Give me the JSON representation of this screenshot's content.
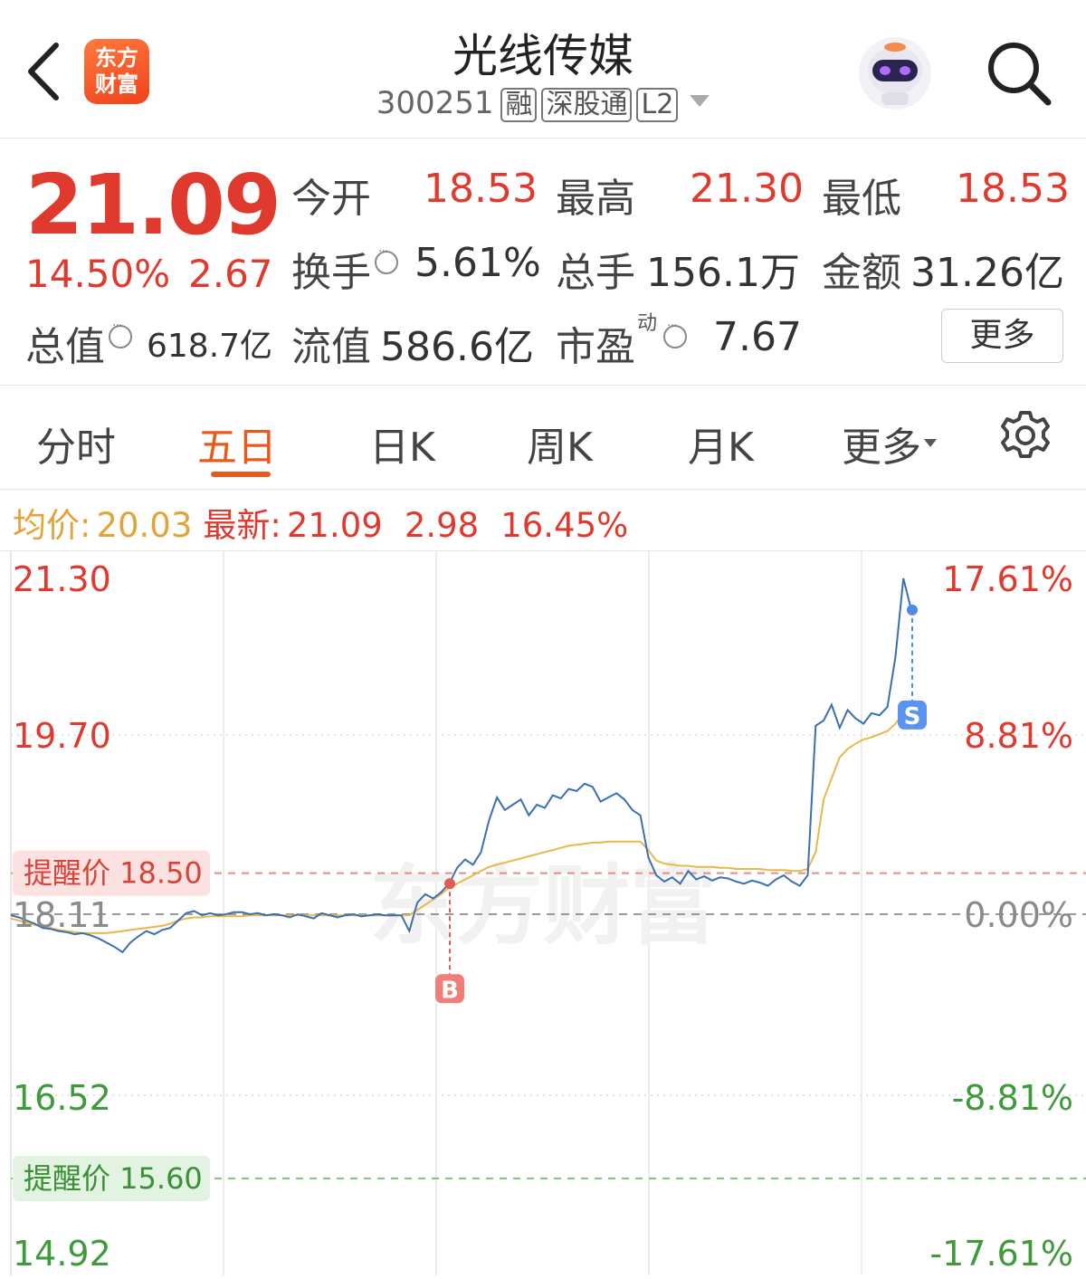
{
  "header": {
    "title": "光线传媒",
    "code": "300251",
    "tags": [
      "融",
      "深股通",
      "L2"
    ],
    "logo_lines": [
      "东方",
      "财富"
    ]
  },
  "quote": {
    "price": "21.09",
    "change_pct": "14.50%",
    "change": "2.67",
    "open_label": "今开",
    "open": "18.53",
    "high_label": "最高",
    "high": "21.30",
    "low_label": "最低",
    "low": "18.53",
    "turnover_label": "换手",
    "turnover": "5.61%",
    "volume_label": "总手",
    "volume": "156.1万",
    "amount_label": "金额",
    "amount": "31.26亿",
    "mcap_label": "总值",
    "mcap": "618.7亿",
    "float_label": "流值",
    "float": "586.6亿",
    "pe_label": "市盈",
    "pe_sup": "动",
    "pe": "7.67",
    "more_label": "更多"
  },
  "tabs": {
    "items": [
      "分时",
      "五日",
      "日K",
      "周K",
      "月K",
      "更多"
    ],
    "active": "五日"
  },
  "summary": {
    "avg_label": "均价:",
    "avg_value": "20.03",
    "latest_label": "最新:",
    "latest_value": "21.09",
    "change": "2.98",
    "change_pct": "16.45%"
  },
  "colors": {
    "up": "#e03a2f",
    "down": "#3e9a3a",
    "price_line": "#3a6fb0",
    "avg_line": "#e8b84a",
    "accent": "#e85a1c"
  },
  "chart_data": {
    "type": "line",
    "title": "",
    "xlabel": "",
    "ylabel": "",
    "days": 5,
    "ylim": [
      14.92,
      21.3
    ],
    "base_price": 18.11,
    "y_ticks_left": [
      "21.30",
      "19.70",
      "18.11",
      "16.52",
      "14.92"
    ],
    "y_ticks_right": [
      "17.61%",
      "8.81%",
      "0.00%",
      "-8.81%",
      "-17.61%"
    ],
    "alerts": [
      {
        "label": "提醒价",
        "value": "18.50",
        "color": "#e03a2f"
      },
      {
        "label": "提醒价",
        "value": "15.60",
        "color": "#3e9a3a"
      }
    ],
    "markers": [
      {
        "label": "B",
        "price": 18.4,
        "day": 2
      },
      {
        "label": "S",
        "price": 21.0,
        "day": 5
      }
    ],
    "watermark": "东方财富",
    "series": [
      {
        "key": "price",
        "values": [
          18.1,
          18.08,
          18.05,
          18.02,
          17.98,
          17.97,
          17.95,
          17.94,
          17.92,
          17.93,
          17.91,
          17.88,
          17.84,
          17.8,
          17.75,
          17.84,
          17.9,
          17.95,
          17.92,
          17.96,
          17.98,
          18.05,
          18.12,
          18.14,
          18.1,
          18.12,
          18.1,
          18.11,
          18.13,
          18.13,
          18.11,
          18.12,
          18.1,
          18.11,
          18.1,
          18.08,
          18.11,
          18.09,
          18.07,
          18.12,
          18.1,
          18.08,
          18.1,
          18.11,
          18.09,
          18.1,
          18.11,
          18.1,
          18.1,
          18.1,
          17.95,
          18.22,
          18.3,
          18.26,
          18.32,
          18.4,
          18.55,
          18.63,
          18.58,
          18.7,
          19.0,
          19.22,
          19.1,
          19.15,
          19.2,
          19.05,
          19.15,
          19.12,
          19.24,
          19.21,
          19.3,
          19.28,
          19.35,
          19.32,
          19.18,
          19.22,
          19.26,
          19.2,
          19.1,
          19.05,
          18.65,
          18.48,
          18.42,
          18.46,
          18.4,
          18.52,
          18.44,
          18.47,
          18.43,
          18.46,
          18.45,
          18.42,
          18.4,
          18.43,
          18.41,
          18.38,
          18.44,
          18.48,
          18.42,
          18.38,
          18.48,
          19.9,
          19.95,
          20.1,
          19.88,
          20.05,
          19.97,
          19.92,
          20.02,
          20.0,
          20.08,
          20.55,
          21.3,
          21.0
        ]
      },
      {
        "key": "avg",
        "values": [
          18.07,
          18.05,
          18.03,
          18.01,
          17.99,
          17.98,
          17.96,
          17.95,
          17.94,
          17.93,
          17.93,
          17.93,
          17.93,
          17.94,
          17.95,
          17.96,
          17.97,
          17.98,
          17.99,
          18.0,
          18.02,
          18.05,
          18.07,
          18.08,
          18.08,
          18.09,
          18.09,
          18.09,
          18.09,
          18.09,
          18.1,
          18.1,
          18.1,
          18.1,
          18.1,
          18.1,
          18.1,
          18.1,
          18.1,
          18.1,
          18.1,
          18.1,
          18.1,
          18.1,
          18.1,
          18.1,
          18.1,
          18.1,
          18.1,
          18.1,
          18.1,
          18.15,
          18.2,
          18.25,
          18.3,
          18.36,
          18.4,
          18.44,
          18.48,
          18.52,
          18.56,
          18.58,
          18.6,
          18.62,
          18.64,
          18.66,
          18.68,
          18.7,
          18.72,
          18.74,
          18.76,
          18.77,
          18.78,
          18.79,
          18.79,
          18.8,
          18.8,
          18.8,
          18.8,
          18.8,
          18.72,
          18.62,
          18.59,
          18.58,
          18.57,
          18.57,
          18.56,
          18.56,
          18.56,
          18.55,
          18.55,
          18.54,
          18.54,
          18.54,
          18.54,
          18.53,
          18.53,
          18.53,
          18.52,
          18.52,
          18.54,
          18.7,
          19.2,
          19.4,
          19.6,
          19.68,
          19.73,
          19.77,
          19.79,
          19.82,
          19.85,
          19.92,
          20.02,
          20.03
        ]
      }
    ]
  }
}
